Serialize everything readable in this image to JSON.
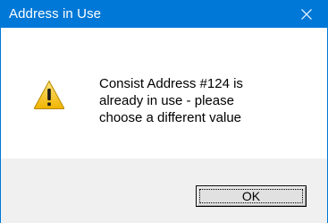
{
  "window": {
    "title": "Address in Use",
    "title_bar_color": "#0078d7",
    "close_icon": "close-icon"
  },
  "message": {
    "icon": "warning-icon",
    "lines": [
      "Consist Address #124 is",
      "already in use - please",
      "choose a different value"
    ]
  },
  "buttons": {
    "ok_label": "OK"
  }
}
